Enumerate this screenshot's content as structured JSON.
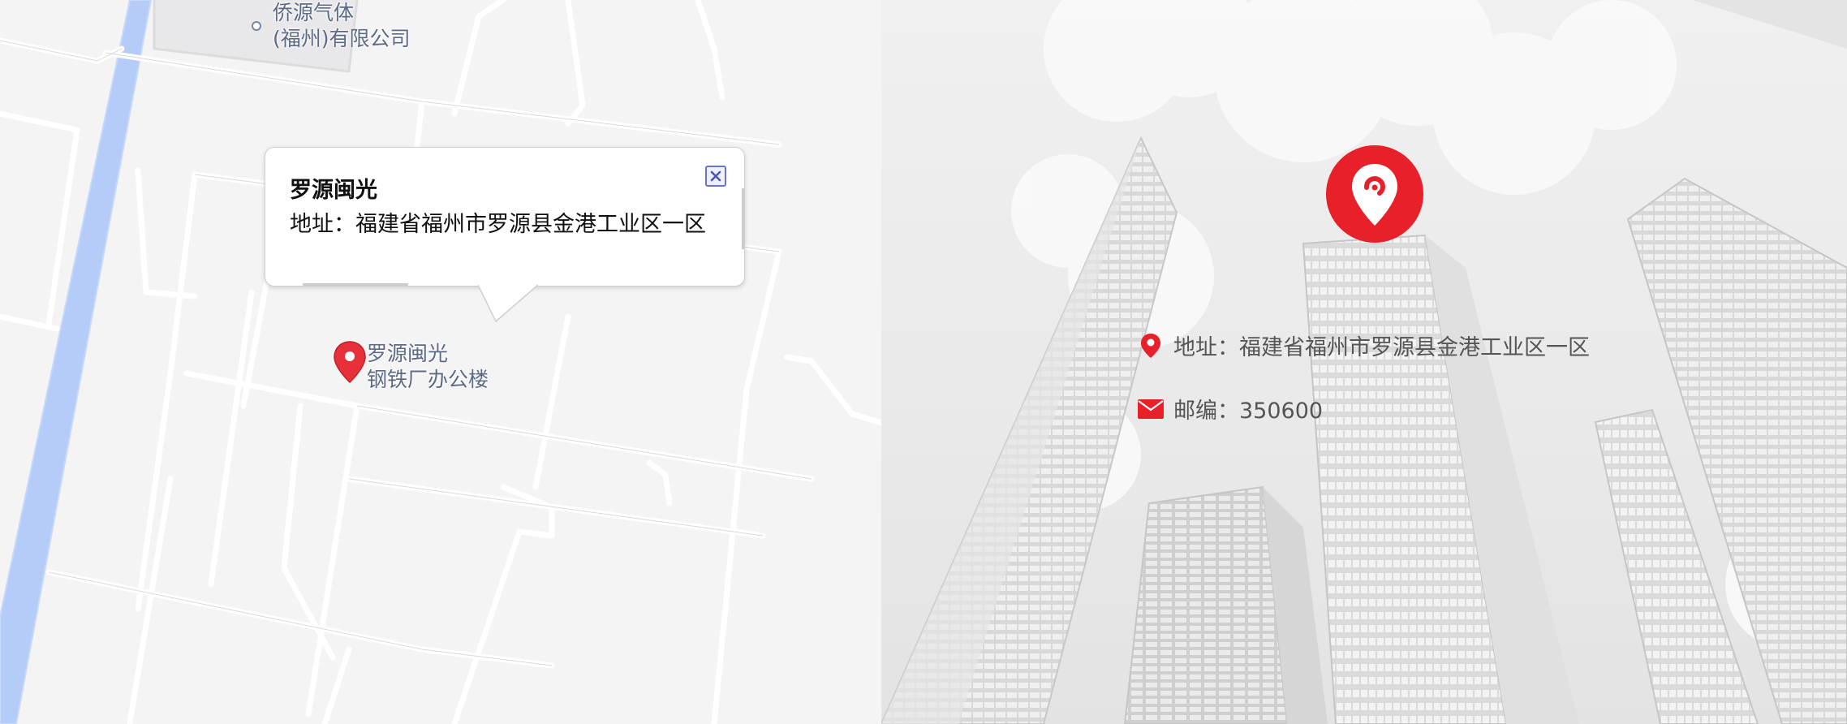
{
  "map": {
    "poi_qiaoyuan": {
      "line1": "侨源气体",
      "line2": "(福州)有限公司"
    },
    "poi_marker": {
      "line1": "罗源闽光",
      "line2": "钢铁厂办公楼"
    },
    "popup": {
      "title": "罗源闽光",
      "address": "地址：福建省福州市罗源县金港工业区一区",
      "close_icon": "close-icon"
    }
  },
  "contact": {
    "address": "地址：福建省福州市罗源县金港工业区一区",
    "postcode": "邮编：350600",
    "accent_color": "#e8202a",
    "icons": [
      "location-pin-icon",
      "mail-icon"
    ]
  }
}
